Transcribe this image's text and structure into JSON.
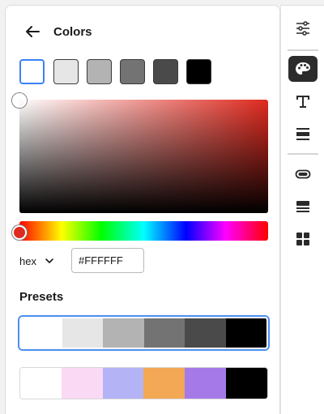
{
  "header": {
    "title": "Colors",
    "back_icon": "arrow-left-icon"
  },
  "swatches": [
    {
      "color": "#ffffff",
      "selected": true
    },
    {
      "color": "#e6e6e6",
      "selected": false
    },
    {
      "color": "#b3b3b3",
      "selected": false
    },
    {
      "color": "#737373",
      "selected": false
    },
    {
      "color": "#4a4a4a",
      "selected": false
    },
    {
      "color": "#000000",
      "selected": false
    }
  ],
  "picker": {
    "hue_color": "#e02a1f"
  },
  "hex": {
    "format_label": "hex",
    "value": "#FFFFFF"
  },
  "presets": {
    "heading": "Presets",
    "rows": [
      {
        "selected": true,
        "colors": [
          "#ffffff",
          "#e6e6e6",
          "#b3b3b3",
          "#737373",
          "#4a4a4a",
          "#000000"
        ]
      },
      {
        "selected": false,
        "colors": [
          "#ffffff",
          "#f9d9f4",
          "#b3b3f6",
          "#f2a854",
          "#a57ae8",
          "#000000"
        ]
      }
    ]
  },
  "rail": {
    "items": [
      {
        "name": "sliders-icon",
        "active": false
      },
      {
        "name": "palette-icon",
        "active": true
      },
      {
        "name": "text-icon",
        "active": false
      },
      {
        "name": "layout-icon",
        "active": false
      },
      {
        "name": "button-shape-icon",
        "active": false
      },
      {
        "name": "stack-icon",
        "active": false
      },
      {
        "name": "grid-icon",
        "active": false
      }
    ]
  },
  "colors": {
    "accent": "#3b82f6",
    "rail_active_bg": "#2c2c2c"
  }
}
